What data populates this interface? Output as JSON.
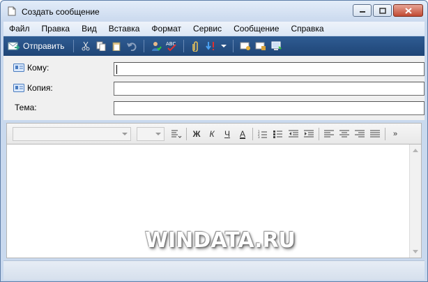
{
  "window": {
    "title": "Создать сообщение",
    "controls": [
      "minimize",
      "maximize",
      "close"
    ]
  },
  "menu": {
    "items": [
      "Файл",
      "Правка",
      "Вид",
      "Вставка",
      "Формат",
      "Сервис",
      "Сообщение",
      "Справка"
    ]
  },
  "toolbar": {
    "send_label": "Отправить",
    "icons": [
      "cut-icon",
      "copy-icon",
      "paste-icon",
      "undo-icon",
      "check-names-icon",
      "spelling-icon",
      "attach-icon",
      "priority-icon",
      "dropdown-icon",
      "sign-icon",
      "encrypt-icon",
      "offline-icon"
    ]
  },
  "fields": {
    "to_label": "Кому:",
    "to_value": "",
    "cc_label": "Копия:",
    "cc_value": "",
    "subject_label": "Тема:",
    "subject_value": ""
  },
  "format_toolbar": {
    "font_name": "",
    "font_size": "",
    "bold_glyph": "Ж",
    "italic_glyph": "К",
    "underline_glyph": "Ч",
    "color_glyph": "А",
    "more_glyph": "»"
  },
  "editor": {
    "body_text": ""
  },
  "watermark": "WINDATA.RU",
  "colors": {
    "toolbar_bg": "#1f4576",
    "window_frame": "#c9d9ee",
    "close_button": "#c14a33"
  }
}
